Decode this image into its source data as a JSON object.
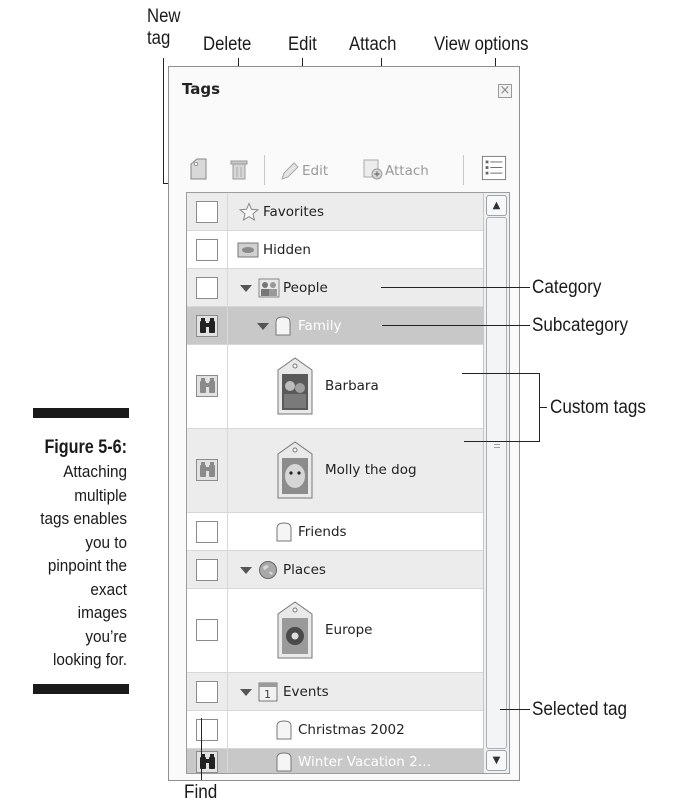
{
  "callouts_top": {
    "new_tag": "New\ntag",
    "delete": "Delete",
    "edit": "Edit",
    "attach": "Attach",
    "view_options": "View options"
  },
  "callouts_right": {
    "category": "Category",
    "subcategory": "Subcategory",
    "custom_tags": "Custom tags",
    "selected_tag": "Selected tag"
  },
  "callout_bottom": {
    "find": "Find"
  },
  "caption": {
    "title": "Figure 5-6:",
    "lines": [
      "Attaching",
      "multiple",
      "tags enables",
      "you to",
      "pinpoint the",
      "exact",
      "images",
      "you’re",
      "looking for."
    ]
  },
  "panel": {
    "title": "Tags",
    "close_symbol": "×",
    "toolbar": {
      "edit_label": "Edit",
      "attach_label": "Attach"
    },
    "rows": [
      {
        "label": "Favorites",
        "icon": "star-icon",
        "find": false,
        "style": "shaded",
        "expander": false
      },
      {
        "label": "Hidden",
        "icon": "hidden-icon",
        "find": false,
        "style": "plain",
        "expander": false
      },
      {
        "label": "People",
        "icon": "people-icon",
        "find": false,
        "style": "shaded",
        "expander": true
      },
      {
        "label": "Family",
        "icon": "tag-icon",
        "find": true,
        "style": "selected",
        "expander": true
      },
      {
        "label": "Barbara",
        "icon": "photo-tag-icon",
        "find": true,
        "style": "plain",
        "expander": false
      },
      {
        "label": "Molly the dog",
        "icon": "photo-tag-icon",
        "find": true,
        "style": "shaded",
        "expander": false
      },
      {
        "label": "Friends",
        "icon": "tag-icon",
        "find": false,
        "style": "plain",
        "expander": false
      },
      {
        "label": "Places",
        "icon": "globe-icon",
        "find": false,
        "style": "shaded",
        "expander": true
      },
      {
        "label": "Europe",
        "icon": "photo-tag-icon",
        "find": false,
        "style": "plain",
        "expander": false
      },
      {
        "label": "Events",
        "icon": "calendar-icon",
        "find": false,
        "style": "shaded",
        "expander": true
      },
      {
        "label": "Christmas 2002",
        "icon": "tag-icon",
        "find": false,
        "style": "plain",
        "expander": false
      },
      {
        "label": "Winter Vacation 2…",
        "icon": "tag-icon",
        "find": true,
        "style": "selected",
        "expander": false
      }
    ]
  },
  "colors": {
    "selected_row": "#c8c8c8",
    "shaded_row": "#ececec",
    "text": "#222222"
  }
}
